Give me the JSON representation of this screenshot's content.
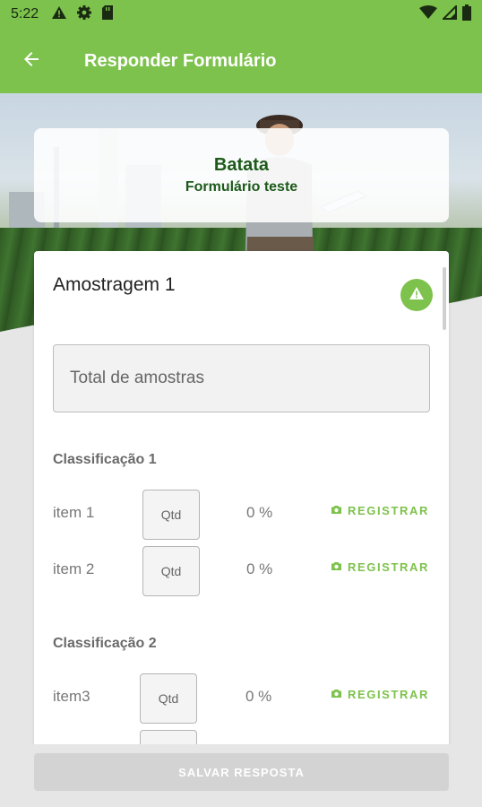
{
  "status_bar": {
    "time": "5:22"
  },
  "app_bar": {
    "title": "Responder Formulário"
  },
  "header_card": {
    "title": "Batata",
    "subtitle": "Formulário teste"
  },
  "form": {
    "section_title": "Amostragem 1",
    "total_input": {
      "placeholder": "Total de amostras",
      "value": ""
    },
    "classifications": [
      {
        "title": "Classificação 1",
        "items": [
          {
            "label": "item 1",
            "qtd_placeholder": "Qtd",
            "percent": "0 %",
            "action": "REGISTRAR"
          },
          {
            "label": "item 2",
            "qtd_placeholder": "Qtd",
            "percent": "0 %",
            "action": "REGISTRAR"
          }
        ]
      },
      {
        "title": "Classificação 2",
        "items": [
          {
            "label": "item3",
            "qtd_placeholder": "Qtd",
            "percent": "0 %",
            "action": "REGISTRAR"
          }
        ]
      }
    ]
  },
  "save_button": {
    "label": "SALVAR RESPOSTA"
  },
  "colors": {
    "primary": "#7dc24c",
    "title_text": "#1d5a1a",
    "disabled_button": "#d3d3d3"
  },
  "icons": [
    "warning-icon",
    "gear-icon",
    "sd-card-icon",
    "wifi-icon",
    "signal-icon",
    "battery-icon",
    "back-arrow-icon",
    "alert-icon",
    "camera-icon"
  ]
}
